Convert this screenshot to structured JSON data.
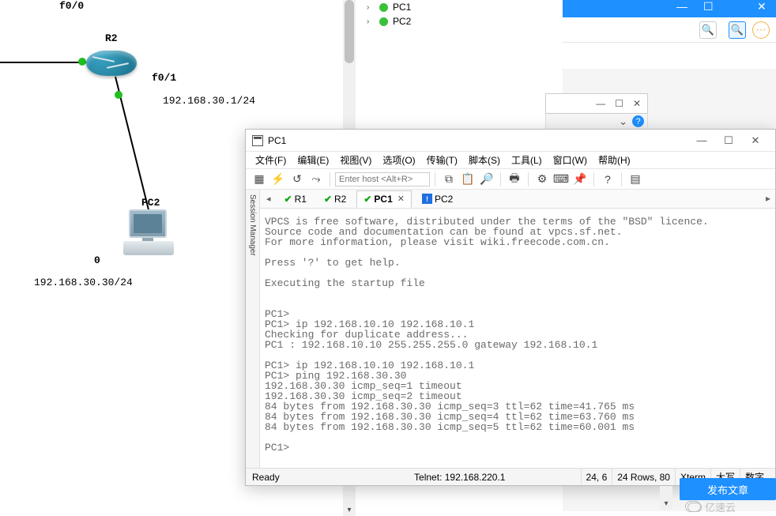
{
  "topology": {
    "iface_f00": "f0/0",
    "router_label": "R2",
    "iface_f01": "f0/1",
    "subnet1": "192.168.30.1/24",
    "pc_label": "PC2",
    "port0": "0",
    "subnet2": "192.168.30.30/24"
  },
  "devices": {
    "pc1": "PC1",
    "pc2": "PC2"
  },
  "bg_window": {
    "min": "—",
    "max": "☐",
    "close": "✕",
    "chev": "⌄",
    "help": "?"
  },
  "toolbar_icons": {
    "search": "🔍",
    "search2": "🔍",
    "more": "⋯"
  },
  "terminal": {
    "title": "PC1",
    "menu": {
      "file": "文件(F)",
      "edit": "编辑(E)",
      "view": "视图(V)",
      "options": "选项(O)",
      "transfer": "传输(T)",
      "script": "脚本(S)",
      "tools": "工具(L)",
      "window": "窗口(W)",
      "help": "帮助(H)"
    },
    "host_placeholder": "Enter host <Alt+R>",
    "session_mgr": "Session Manager",
    "tabs": {
      "r1": "R1",
      "r2": "R2",
      "pc1": "PC1",
      "pc2": "PC2"
    },
    "console_text": "VPCS is free software, distributed under the terms of the \"BSD\" licence.\nSource code and documentation can be found at vpcs.sf.net.\nFor more information, please visit wiki.freecode.com.cn.\n\nPress '?' to get help.\n\nExecuting the startup file\n\n\nPC1>\nPC1> ip 192.168.10.10 192.168.10.1\nChecking for duplicate address...\nPC1 : 192.168.10.10 255.255.255.0 gateway 192.168.10.1\n\nPC1> ip 192.168.10.10 192.168.10.1\nPC1> ping 192.168.30.30\n192.168.30.30 icmp_seq=1 timeout\n192.168.30.30 icmp_seq=2 timeout\n84 bytes from 192.168.30.30 icmp_seq=3 ttl=62 time=41.765 ms\n84 bytes from 192.168.30.30 icmp_seq=4 ttl=62 time=63.760 ms\n84 bytes from 192.168.30.30 icmp_seq=5 ttl=62 time=60.001 ms\n\nPC1>",
    "status": {
      "ready": "Ready",
      "telnet": "Telnet: 192.168.220.1",
      "pos": "24,   6",
      "size": "24 Rows, 80",
      "term": "Xterm",
      "caps": "大写",
      "num": "数字"
    },
    "win": {
      "min": "—",
      "max": "☐",
      "close": "✕"
    }
  },
  "footer": {
    "publish": "发布文章",
    "watermark": "亿速云"
  },
  "icons": {
    "triangle_left": "◂",
    "triangle_down": "▾",
    "caret_right": "›"
  }
}
